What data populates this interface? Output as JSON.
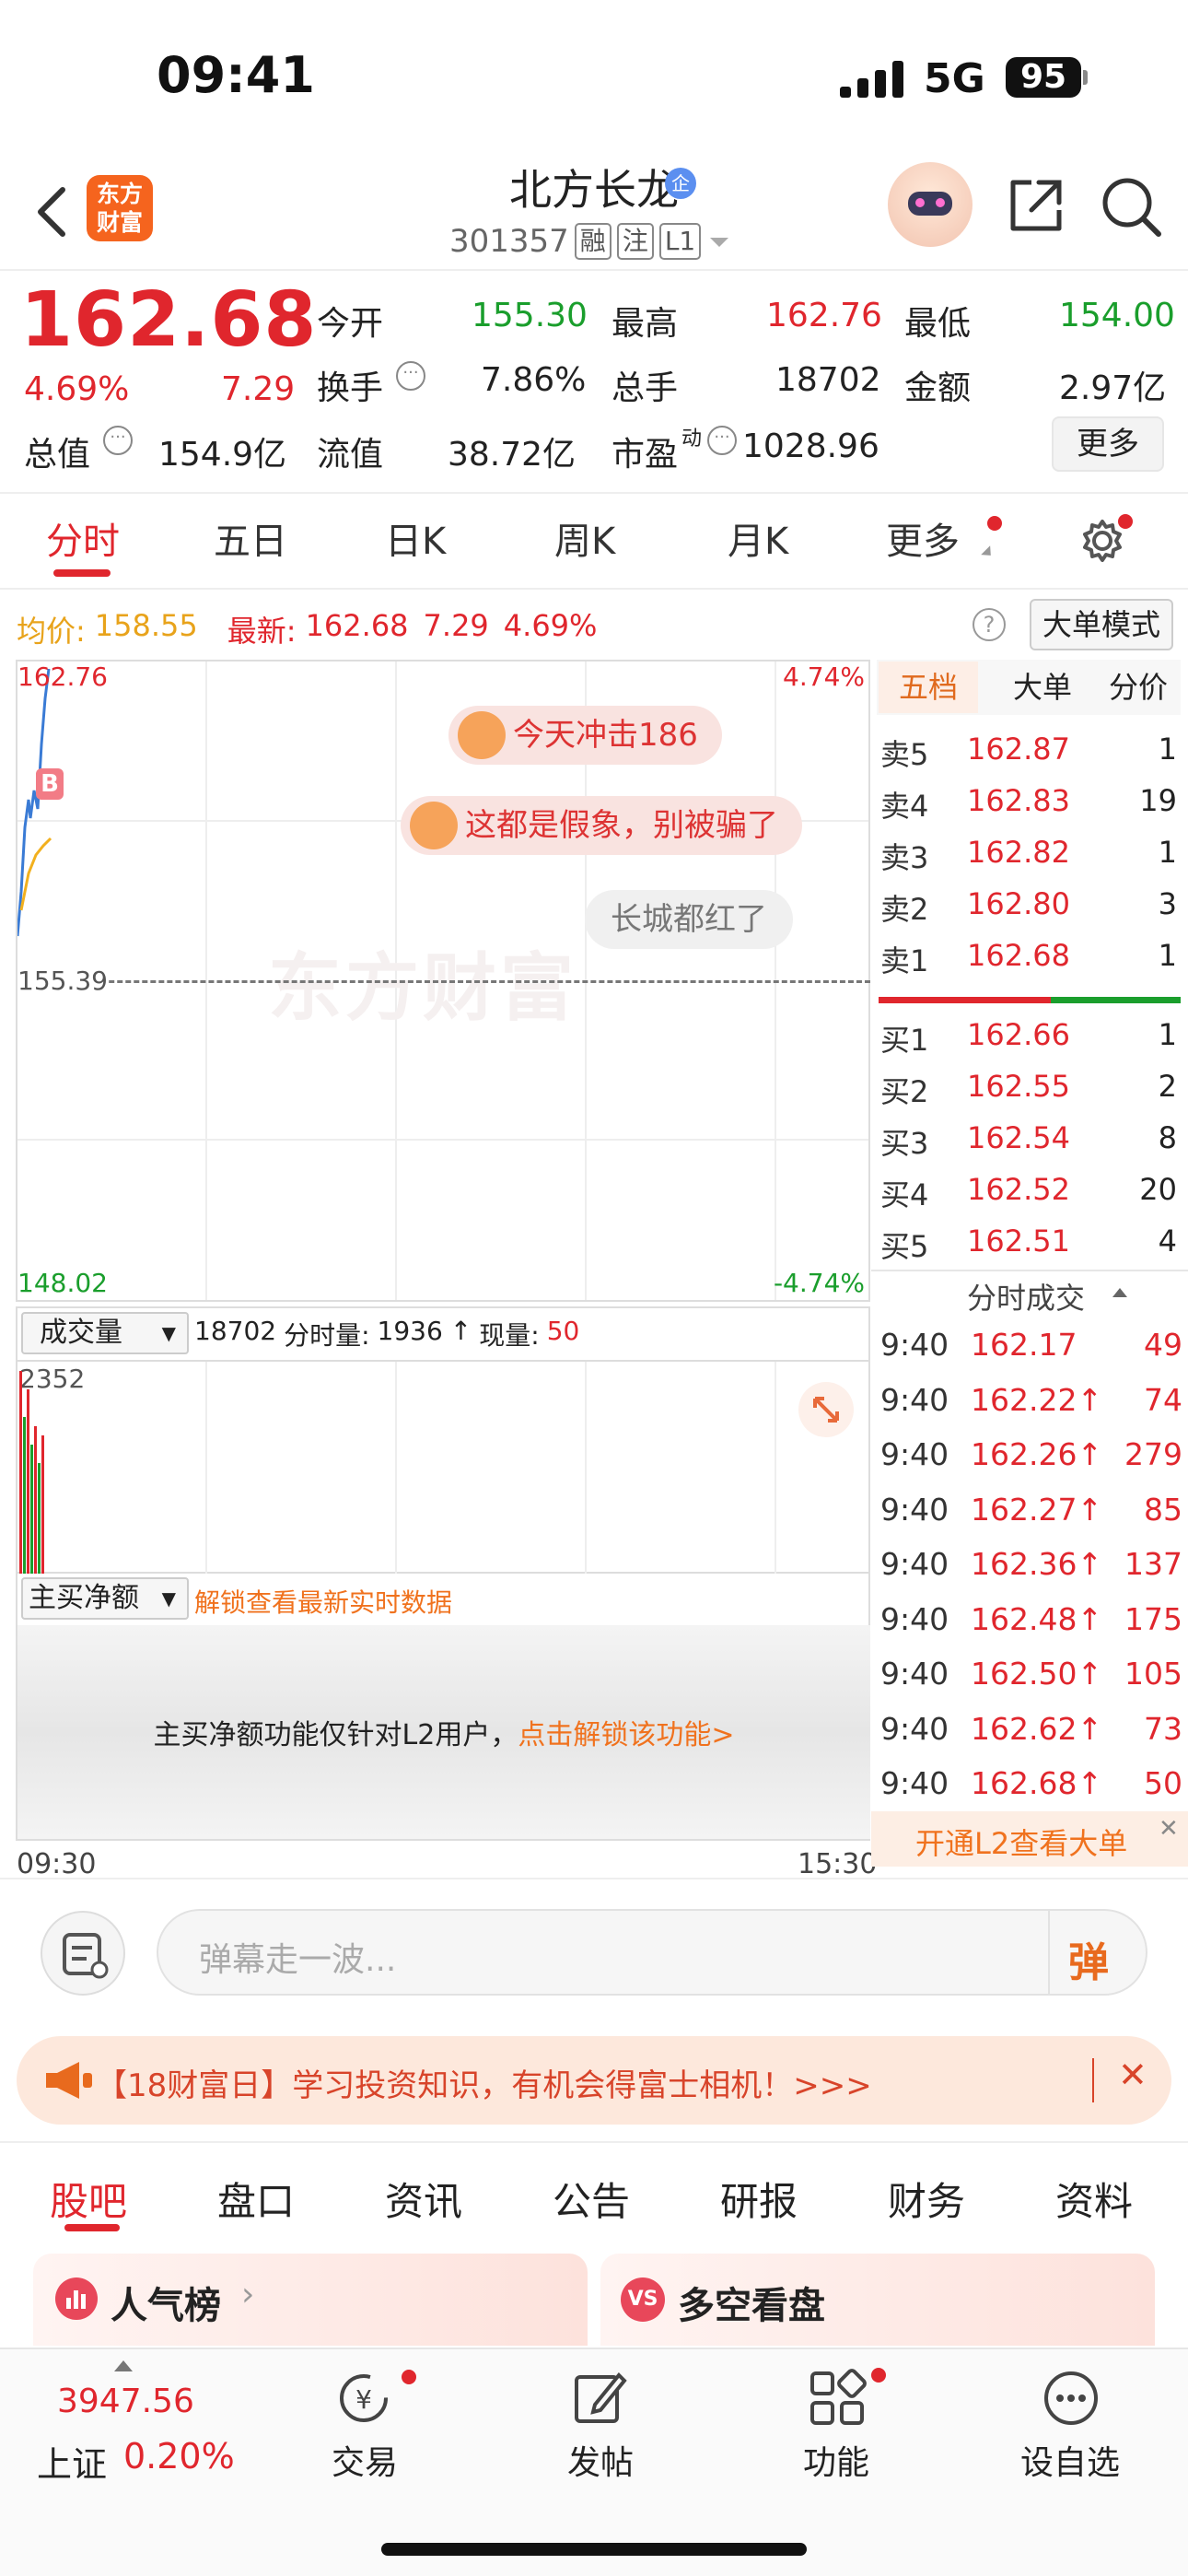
{
  "status_bar": {
    "time": "09:41",
    "network": "5G",
    "battery": "95"
  },
  "header": {
    "logo_line1": "东方",
    "logo_line2": "财富",
    "stock_name": "北方长龙",
    "verify_badge": "企",
    "stock_code": "301357",
    "tags": [
      "融",
      "注",
      "L1"
    ]
  },
  "quote": {
    "price": "162.68",
    "change_pct": "4.69%",
    "change": "7.29",
    "open_label": "今开",
    "open": "155.30",
    "high_label": "最高",
    "high": "162.76",
    "low_label": "最低",
    "low": "154.00",
    "turnover_label": "换手",
    "turnover": "7.86%",
    "volume_label": "总手",
    "volume": "18702",
    "amount_label": "金额",
    "amount": "2.97亿",
    "mktcap_label": "总值",
    "mktcap": "154.9亿",
    "float_label": "流值",
    "float_cap": "38.72亿",
    "pe_label": "市盈",
    "pe_sup": "动",
    "pe": "1028.96",
    "more_button": "更多"
  },
  "chart_tabs": [
    "分时",
    "五日",
    "日K",
    "周K",
    "月K",
    "更多"
  ],
  "info_line": {
    "avg_label": "均价:",
    "avg": "158.55",
    "latest_label": "最新:",
    "latest": "162.68",
    "change": "7.29",
    "pct": "4.69%",
    "big_order_mode": "大单模式"
  },
  "chart": {
    "max_price": "162.76",
    "prev_close": "155.39",
    "min_price": "148.02",
    "max_pct": "4.74%",
    "min_pct": "-4.74%",
    "b_marker": "B",
    "watermark": "东方财富",
    "time_start": "09:30",
    "time_end": "15:30"
  },
  "danmaku": [
    "今天冲击186",
    "这都是假象，别被骗了",
    "长城都红了"
  ],
  "volume_panel": {
    "selector": "成交量",
    "volume": "18702",
    "fenshi_label": "分时量:",
    "fenshi": "1936",
    "arrow": "↑",
    "now_label": "现量:",
    "now": "50",
    "max_label": "2352"
  },
  "net_buy_panel": {
    "selector": "主买净额",
    "unlock_hint": "解锁查看最新实时数据",
    "notice_prefix": "主买净额功能仅针对L2用户，",
    "notice_link": "点击解锁该功能>"
  },
  "order_book": {
    "tabs": [
      "五档",
      "大单",
      "分价"
    ],
    "asks": [
      {
        "label": "卖5",
        "price": "162.87",
        "vol": "1"
      },
      {
        "label": "卖4",
        "price": "162.83",
        "vol": "19"
      },
      {
        "label": "卖3",
        "price": "162.82",
        "vol": "1"
      },
      {
        "label": "卖2",
        "price": "162.80",
        "vol": "3"
      },
      {
        "label": "卖1",
        "price": "162.68",
        "vol": "1"
      }
    ],
    "bids": [
      {
        "label": "买1",
        "price": "162.66",
        "vol": "1"
      },
      {
        "label": "买2",
        "price": "162.55",
        "vol": "2"
      },
      {
        "label": "买3",
        "price": "162.54",
        "vol": "8"
      },
      {
        "label": "买4",
        "price": "162.52",
        "vol": "20"
      },
      {
        "label": "买5",
        "price": "162.51",
        "vol": "4"
      }
    ],
    "ratio_red": 0.57
  },
  "trades": {
    "title": "分时成交",
    "rows": [
      {
        "time": "9:40",
        "price": "162.17",
        "vol": "49"
      },
      {
        "time": "9:40",
        "price": "162.22↑",
        "vol": "74"
      },
      {
        "time": "9:40",
        "price": "162.26↑",
        "vol": "279"
      },
      {
        "time": "9:40",
        "price": "162.27↑",
        "vol": "85"
      },
      {
        "time": "9:40",
        "price": "162.36↑",
        "vol": "137"
      },
      {
        "time": "9:40",
        "price": "162.48↑",
        "vol": "175"
      },
      {
        "time": "9:40",
        "price": "162.50↑",
        "vol": "105"
      },
      {
        "time": "9:40",
        "price": "162.62↑",
        "vol": "73"
      },
      {
        "time": "9:40",
        "price": "162.68↑",
        "vol": "50"
      }
    ],
    "l2_banner": "开通L2查看大单"
  },
  "comment_bar": {
    "placeholder": "弹幕走一波...",
    "send_label": "弹"
  },
  "promo": {
    "text": "【18财富日】学习投资知识，有机会得富士相机！>>>"
  },
  "section_tabs": [
    "股吧",
    "盘口",
    "资讯",
    "公告",
    "研报",
    "财务",
    "资料"
  ],
  "cards": {
    "popularity": "人气榜",
    "long_short": "多空看盘",
    "vs": "VS"
  },
  "bottom_nav": {
    "index_value": "3947.56",
    "index_name": "上证",
    "index_pct": "0.20%",
    "trade": "交易",
    "post": "发帖",
    "functions": "功能",
    "watchlist": "设自选"
  }
}
